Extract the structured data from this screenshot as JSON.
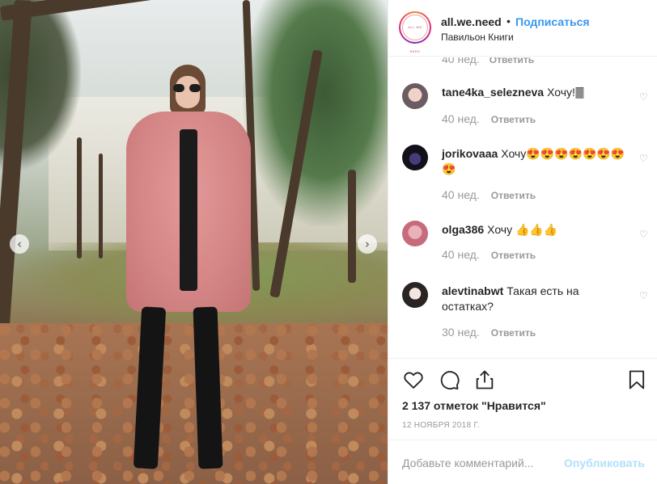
{
  "post": {
    "username": "all.we.need",
    "separator": "•",
    "follow_label": "Подписаться",
    "location": "Павильон Книги",
    "avatar_text": "ALL WE NEED"
  },
  "carousel": {
    "prev_icon": "‹",
    "next_icon": "›"
  },
  "partial_comment": {
    "time": "40 нед.",
    "reply": "Ответить"
  },
  "comments": [
    {
      "username": "tane4ka_selezneva",
      "text": "Хочу!🀫",
      "time": "40 нед.",
      "reply": "Ответить"
    },
    {
      "username": "jorikovaaa",
      "text": "Хочу😍😍😍😍😍😍😍😍",
      "time": "40 нед.",
      "reply": "Ответить"
    },
    {
      "username": "olga386",
      "text": "Хочу 👍👍👍",
      "time": "40 нед.",
      "reply": "Ответить"
    },
    {
      "username": "alevtinabwt",
      "text": "Такая есть на остатках?",
      "time": "30 нед.",
      "reply": "Ответить"
    }
  ],
  "likes": "2 137 отметок \"Нравится\"",
  "date": "12 НОЯБРЯ 2018 Г.",
  "add_comment": {
    "placeholder": "Добавьте комментарий...",
    "publish": "Опубликовать"
  },
  "colors": {
    "link": "#3897f0",
    "muted": "#999999",
    "publish_disabled": "#b2dffc"
  }
}
